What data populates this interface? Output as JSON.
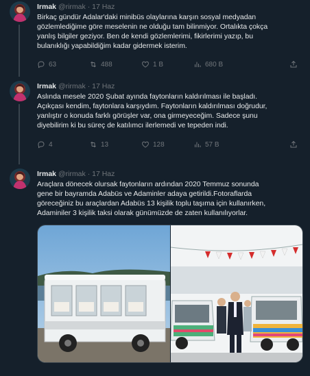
{
  "tweets": [
    {
      "name": "Irmak",
      "handle": "@rirmak",
      "separator": "·",
      "date": "17 Haz",
      "lines": [
        "Birkaç gündür Adalar'daki minibüs olaylarına karşın sosyal medyadan",
        "gözlemlediğime göre meselenin ne olduğu tam bilinmiyor. Ortalıkta çokça",
        "yanlış bilgiler geziyor.  Ben de kendi gözlemlerimi, fikirlerimi yazıp, bu",
        "bulanıklığı yapabildiğim kadar gidermek isterim."
      ],
      "replies": "63",
      "retweets": "488",
      "likes": "1 B",
      "views": "680 B"
    },
    {
      "name": "Irmak",
      "handle": "@rirmak",
      "separator": "·",
      "date": "17 Haz",
      "lines": [
        "Aslında mesele 2020 Şubat ayında faytonların kaldırılması ile başladı.",
        "Açıkçası kendim, faytonlara karşıydım. Faytonların kaldırılması doğrudur,",
        "yanlıştır o konuda farklı görüşler var, ona girmeyeceğim. Sadece şunu",
        "diyebilirim ki bu süreç de katılımcı ilerlemedi ve tepeden indi."
      ],
      "replies": "4",
      "retweets": "13",
      "likes": "128",
      "views": "57 B"
    },
    {
      "name": "Irmak",
      "handle": "@rirmak",
      "separator": "·",
      "date": "17 Haz",
      "lines": [
        "Araçlara dönecek olursak faytonların ardından 2020 Temmuz sonunda",
        "gene bir bayramda Adabüs ve Adaminler adaya getirildi.Fotoraflarda",
        "göreceğiniz bu araçlardan Adabüs 13 kişilik toplu taşıma için kullanırken,",
        "Adaminiler 3 kişilik taksi olarak günümüzde de zaten kullanılıyorlar."
      ]
    }
  ],
  "colors": {
    "background": "#15202b",
    "text": "#e7e9ea",
    "muted": "#71767b",
    "border": "#38444d"
  },
  "icons": [
    "reply-icon",
    "retweet-icon",
    "like-icon",
    "views-icon",
    "share-icon"
  ]
}
